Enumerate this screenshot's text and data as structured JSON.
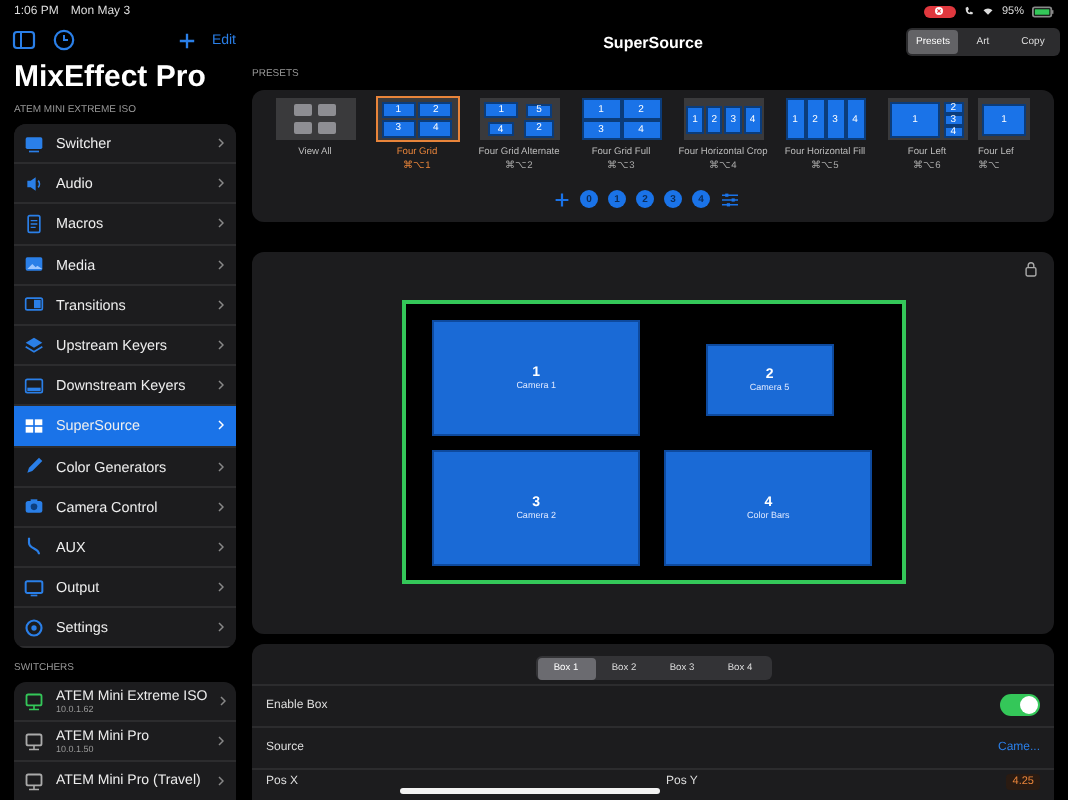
{
  "status_bar": {
    "time": "1:06 PM",
    "date": "Mon May 3",
    "battery": "95%"
  },
  "sidebar": {
    "edit": "Edit",
    "title": "MixEffect Pro",
    "section": "ATEM MINI EXTREME ISO",
    "items": [
      {
        "label": "Switcher",
        "selected": false
      },
      {
        "label": "Audio",
        "selected": false
      },
      {
        "label": "Macros",
        "selected": false
      },
      {
        "label": "Media",
        "selected": false
      },
      {
        "label": "Transitions",
        "selected": false
      },
      {
        "label": "Upstream Keyers",
        "selected": false
      },
      {
        "label": "Downstream Keyers",
        "selected": false
      },
      {
        "label": "SuperSource",
        "selected": true
      },
      {
        "label": "Color Generators",
        "selected": false
      },
      {
        "label": "Camera Control",
        "selected": false
      },
      {
        "label": "AUX",
        "selected": false
      },
      {
        "label": "Output",
        "selected": false
      },
      {
        "label": "Settings",
        "selected": false
      }
    ],
    "switchers_header": "SWITCHERS",
    "switchers": [
      {
        "name": "ATEM Mini Extreme ISO",
        "ip": "10.0.1.62",
        "connected": true
      },
      {
        "name": "ATEM Mini Pro",
        "ip": "10.0.1.50",
        "connected": false
      },
      {
        "name": "ATEM Mini Pro (Travel)",
        "connected": false
      }
    ]
  },
  "main": {
    "title": "SuperSource",
    "view_tabs": [
      {
        "label": "Presets",
        "selected": true
      },
      {
        "label": "Art",
        "selected": false
      },
      {
        "label": "Copy",
        "selected": false
      }
    ],
    "presets_header": "PRESETS",
    "presets": [
      {
        "kind": "view_all",
        "label": "View All",
        "selected": false
      },
      {
        "kind": "grid",
        "label": "Four Grid",
        "shortcut": "⌘⌥1",
        "tiles": [
          "1",
          "2",
          "3",
          "4"
        ],
        "selected": true
      },
      {
        "kind": "alternate",
        "label": "Four Grid Alternate",
        "shortcut": "⌘⌥2",
        "tiles": [
          "1",
          "5",
          "4",
          "2"
        ],
        "selected": false
      },
      {
        "kind": "full",
        "label": "Four Grid Full",
        "shortcut": "⌘⌥3",
        "tiles": [
          "1",
          "2",
          "3",
          "4"
        ],
        "selected": false
      },
      {
        "kind": "hcrop",
        "label": "Four Horizontal Crop",
        "shortcut": "⌘⌥4",
        "tiles": [
          "1",
          "2",
          "3",
          "4"
        ],
        "selected": false
      },
      {
        "kind": "hfill",
        "label": "Four Horizontal Fill",
        "shortcut": "⌘⌥5",
        "tiles": [
          "1",
          "2",
          "3",
          "4"
        ],
        "selected": false
      },
      {
        "kind": "left",
        "label": "Four Left",
        "shortcut": "⌘⌥6",
        "tiles": [
          "1",
          "2",
          "3",
          "4"
        ],
        "selected": false
      },
      {
        "kind": "left_cut",
        "label": "Four Lef",
        "shortcut": "⌘⌥",
        "tiles": [
          "1"
        ],
        "selected": false
      }
    ],
    "pages": [
      "0",
      "1",
      "2",
      "3",
      "4"
    ],
    "canvas": {
      "locked": true,
      "boxes": [
        {
          "number": "1",
          "source": "Camera 1"
        },
        {
          "number": "2",
          "source": "Camera 5"
        },
        {
          "number": "3",
          "source": "Camera 2"
        },
        {
          "number": "4",
          "source": "Color Bars"
        }
      ]
    },
    "box_settings": {
      "tabs": [
        {
          "label": "Box 1",
          "selected": true
        },
        {
          "label": "Box 2",
          "selected": false
        },
        {
          "label": "Box 3",
          "selected": false
        },
        {
          "label": "Box 4",
          "selected": false
        }
      ],
      "enable_box": {
        "label": "Enable Box",
        "on": true
      },
      "source": {
        "label": "Source",
        "value": "Came..."
      },
      "pos_x": {
        "label": "Pos X"
      },
      "pos_y": {
        "label": "Pos Y",
        "value": "4.25"
      }
    }
  }
}
